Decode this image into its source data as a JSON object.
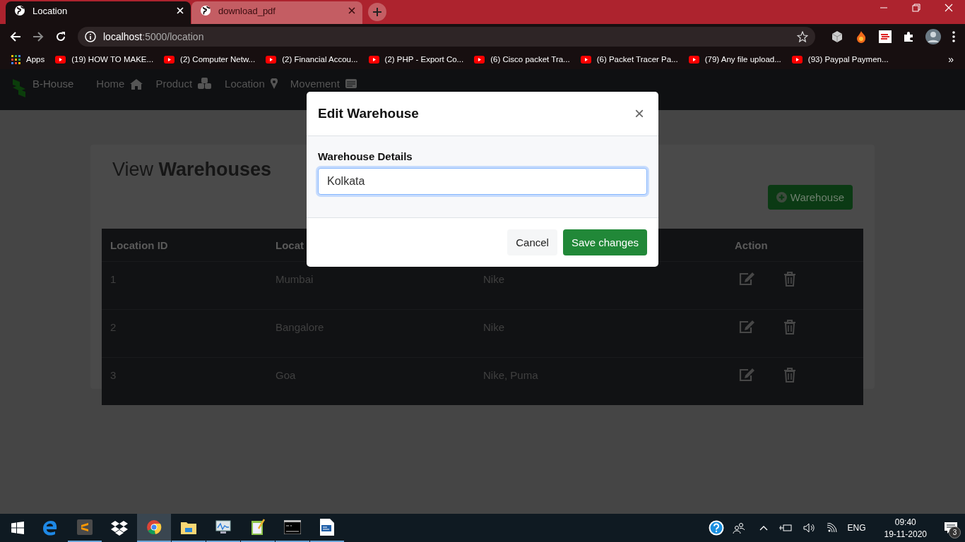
{
  "browser": {
    "tabs": [
      {
        "title": "Location",
        "selected": true
      },
      {
        "title": "download_pdf",
        "selected": false
      }
    ],
    "url": {
      "host": "localhost",
      "path": ":5000/location"
    },
    "bookmarks": [
      {
        "kind": "apps",
        "label": "Apps"
      },
      {
        "kind": "video",
        "label": "(19) HOW TO MAKE..."
      },
      {
        "kind": "video",
        "label": "(2) Computer Netw..."
      },
      {
        "kind": "video",
        "label": "(2) Financial Accou..."
      },
      {
        "kind": "video",
        "label": "(2) PHP - Export Co..."
      },
      {
        "kind": "video",
        "label": "(6) Cisco packet Tra..."
      },
      {
        "kind": "video",
        "label": "(6) Packet Tracer Pa..."
      },
      {
        "kind": "video",
        "label": "(79) Any file upload..."
      },
      {
        "kind": "video",
        "label": "(93) Paypal Paymen..."
      }
    ],
    "more": "»"
  },
  "navbar": {
    "brand": "B-House",
    "items": [
      {
        "label": "Home"
      },
      {
        "label": "Product"
      },
      {
        "label": "Location"
      },
      {
        "label": "Movement"
      }
    ]
  },
  "page": {
    "title": "View **Warehouses**",
    "add_button": "Warehouse"
  },
  "table": {
    "columns": [
      {
        "label": "Location ID"
      },
      {
        "label": "Locat"
      },
      {},
      {
        "label": "Action"
      }
    ],
    "rows": [
      [
        "1",
        "Mumbai",
        "Nike"
      ],
      [
        "2",
        "Bangalore",
        "Nike"
      ],
      [
        "3",
        "Goa",
        "Nike, Puma"
      ]
    ]
  },
  "modal": {
    "title": "Edit Warehouse",
    "close": "×",
    "label": "Warehouse Details",
    "value": "Kolkata",
    "cancel": "Cancel",
    "save": "Save changes"
  },
  "taskbar": {
    "apps": [
      {
        "kind": "edge",
        "selected": false,
        "running": false
      },
      {
        "kind": "sublime",
        "selected": false,
        "running": true
      },
      {
        "kind": "dropbox",
        "selected": false,
        "running": false
      },
      {
        "kind": "chrome",
        "selected": true,
        "running": true
      },
      {
        "kind": "explorer",
        "selected": false,
        "running": true
      },
      {
        "kind": "monitor",
        "selected": false,
        "running": true
      },
      {
        "kind": "notepad",
        "selected": false,
        "running": true
      },
      {
        "kind": "terminal",
        "selected": false,
        "running": true
      },
      {
        "kind": "document",
        "selected": false,
        "running": true
      }
    ],
    "language": "ENG",
    "time": "09:40",
    "date": "19-11-2020",
    "notifications": "3"
  }
}
